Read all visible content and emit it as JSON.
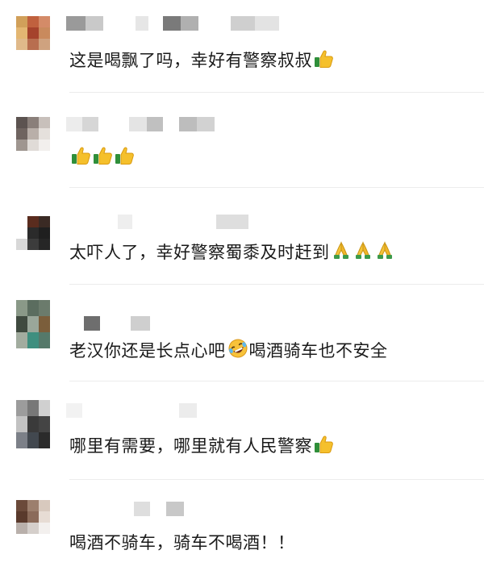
{
  "comments": [
    {
      "text": "这是喝飘了吗，幸好有警察叔叔",
      "emoji": [
        "thumbs-up"
      ],
      "avatar_colors": [
        "#d1a05a",
        "#c0613e",
        "#d48b68",
        "#e3b672",
        "#a5432c",
        "#c98a5d",
        "#e0b98a",
        "#b86e4f",
        "#cfa27f"
      ]
    },
    {
      "text": "",
      "emoji": [
        "thumbs-up",
        "thumbs-up",
        "thumbs-up"
      ],
      "avatar_colors": [
        "#5c5350",
        "#8a7f7a",
        "#c8c0bb",
        "#6f6460",
        "#b9afa9",
        "#e5e0dc",
        "#9f9690",
        "#e0dbd7",
        "#f2efed"
      ]
    },
    {
      "text": "太吓人了，幸好警察蜀黍及时赶到",
      "emoji": [
        "folded-hands",
        "folded-hands",
        "folded-hands"
      ],
      "avatar_colors": [
        "#ffffff",
        "#5a2c1e",
        "#3a2a24",
        "#ffffff",
        "#2b2b2b",
        "#1f1f1f",
        "#d8d8d8",
        "#3c3c3c",
        "#262626"
      ]
    },
    {
      "text": "老汉你还是长点心吧",
      "emoji": [
        "rolling-laughing"
      ],
      "text_after": "喝酒骑车也不安全",
      "avatar_colors": [
        "#8a9988",
        "#5b6d5f",
        "#6b7b6c",
        "#3f4a3f",
        "#9aa79a",
        "#7b5e3b",
        "#a2ac9f",
        "#3e8f7f",
        "#55796a"
      ]
    },
    {
      "text": "哪里有需要，哪里就有人民警察",
      "emoji": [
        "thumbs-up"
      ],
      "avatar_colors": [
        "#9c9c9c",
        "#787878",
        "#d0d0d0",
        "#c2c2c2",
        "#3a3a3a",
        "#444444",
        "#7c8088",
        "#42484f",
        "#2b2b2b"
      ]
    },
    {
      "text": "喝酒不骑车，骑车不喝酒！！",
      "emoji": [],
      "avatar_colors": [
        "#6b4a3a",
        "#9c7f6d",
        "#d8c9be",
        "#5a3a2c",
        "#8b6b5a",
        "#e7dcd4",
        "#b9b0ab",
        "#d5cfcb",
        "#f3f0ee"
      ]
    }
  ]
}
